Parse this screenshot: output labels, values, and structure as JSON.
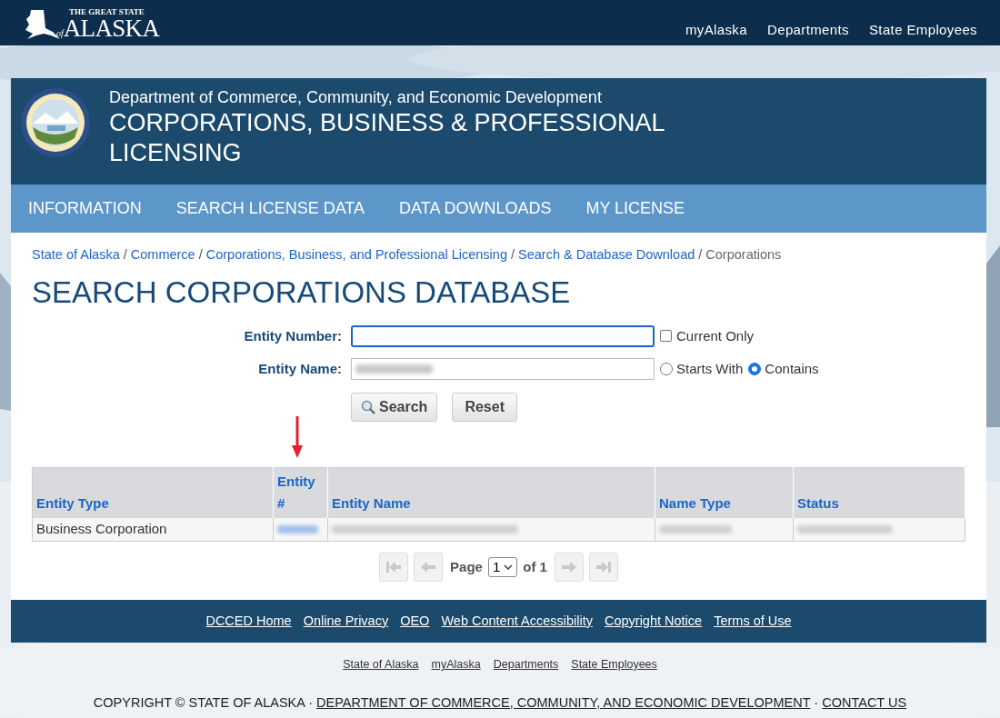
{
  "top_bar": {
    "logo_small": "THE GREAT STATE",
    "logo_of": "of",
    "logo_big": "ALASKA",
    "links": [
      "myAlaska",
      "Departments",
      "State Employees"
    ]
  },
  "header": {
    "department": "Department of Commerce, Community, and Economic Development",
    "title": "CORPORATIONS, BUSINESS & PROFESSIONAL LICENSING"
  },
  "nav": [
    "INFORMATION",
    "SEARCH LICENSE DATA",
    "DATA DOWNLOADS",
    "MY LICENSE"
  ],
  "breadcrumb_separator": "/",
  "breadcrumbs": [
    {
      "label": "State of Alaska",
      "kind": "link"
    },
    {
      "label": "Commerce",
      "kind": "link"
    },
    {
      "label": "Corporations, Business, and Professional Licensing",
      "kind": "link"
    },
    {
      "label": "Search & Database Download",
      "kind": "link"
    },
    {
      "label": "Corporations",
      "kind": "current"
    }
  ],
  "page_title": "SEARCH CORPORATIONS DATABASE",
  "form": {
    "entity_number": {
      "label": "Entity Number:",
      "focused": true
    },
    "current_only": {
      "label": "Current Only",
      "checked": false
    },
    "entity_name": {
      "label": "Entity Name:"
    },
    "match_options": [
      {
        "label": "Starts With",
        "selected": false
      },
      {
        "label": "Contains",
        "selected": true
      }
    ],
    "buttons": [
      {
        "label": "Search",
        "kind": "search"
      },
      {
        "label": "Reset",
        "kind": "plain"
      }
    ]
  },
  "table": {
    "columns": [
      "Entity Type",
      "Entity #",
      "Entity Name",
      "Name Type",
      "Status"
    ],
    "rows": [
      [
        "Business Corporation"
      ]
    ]
  },
  "pagination": {
    "page_label": "Page",
    "page": "1",
    "of_label": "of 1"
  },
  "footer_links": [
    "DCCED Home",
    "Online Privacy",
    "OEO",
    "Web Content Accessibility",
    "Copyright Notice",
    "Terms of Use"
  ],
  "bottom_links": [
    "State of Alaska",
    "myAlaska",
    "Departments",
    "State Employees"
  ],
  "copyright": [
    {
      "kind": "text",
      "text": "COPYRIGHT © STATE OF ALASKA ·"
    },
    {
      "kind": "link",
      "text": "DEPARTMENT OF COMMERCE, COMMUNITY, AND ECONOMIC DEVELOPMENT"
    },
    {
      "kind": "text",
      "text": "·"
    },
    {
      "kind": "link",
      "text": "CONTACT US"
    }
  ]
}
